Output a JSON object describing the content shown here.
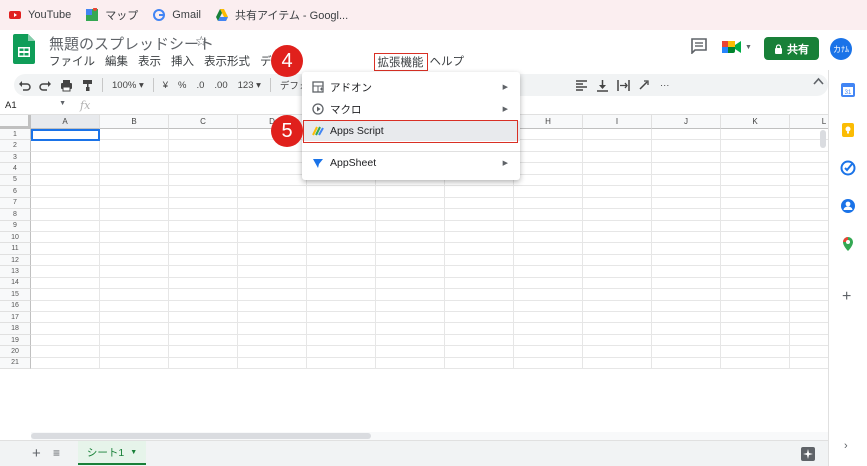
{
  "bookmarks": [
    {
      "label": "YouTube",
      "icon": "youtube-icon"
    },
    {
      "label": "マップ",
      "icon": "maps-icon"
    },
    {
      "label": "Gmail",
      "icon": "google-icon"
    },
    {
      "label": "共有アイテム - Googl...",
      "icon": "drive-icon"
    }
  ],
  "doc": {
    "title": "無題のスプレッドシート",
    "star": "☆"
  },
  "menu": {
    "file": "ファイル",
    "edit": "編集",
    "view": "表示",
    "insert": "挿入",
    "format": "表示形式",
    "data": "データ",
    "extensions": "拡張機能",
    "help": "ヘルプ"
  },
  "header": {
    "share_label": "共有",
    "avatar_text": "カﾅﾑ"
  },
  "toolbar": {
    "zoom": "100%",
    "currency": "¥",
    "percent": "%",
    "dec_decrease": ".0",
    "dec_increase": ".00",
    "format_more": "123",
    "font": "デフォル"
  },
  "formula": {
    "cell_ref": "A1",
    "fx": "fx"
  },
  "grid": {
    "columns": [
      "A",
      "B",
      "C",
      "D",
      "E",
      "F",
      "G",
      "H",
      "I",
      "J",
      "K",
      "L"
    ],
    "rows": [
      "1",
      "2",
      "3",
      "4",
      "5",
      "6",
      "7",
      "8",
      "9",
      "10",
      "11",
      "12",
      "13",
      "14",
      "15",
      "16",
      "17",
      "18",
      "19",
      "20",
      "21"
    ]
  },
  "dropdown": {
    "items": [
      {
        "label": "アドオン",
        "icon": "addon-icon",
        "has_submenu": true
      },
      {
        "label": "マクロ",
        "icon": "macro-icon",
        "has_submenu": true
      },
      {
        "label": "Apps Script",
        "icon": "apps-script-icon",
        "has_submenu": false
      },
      {
        "label": "AppSheet",
        "icon": "appsheet-icon",
        "has_submenu": true
      }
    ]
  },
  "steps": {
    "step4": "4",
    "step5": "5"
  },
  "sheets": {
    "tab_label": "シート1"
  },
  "colors": {
    "brand_green": "#188038",
    "accent_blue": "#1a73e8",
    "highlight_red": "#d93025",
    "badge_red": "#e0201c"
  }
}
